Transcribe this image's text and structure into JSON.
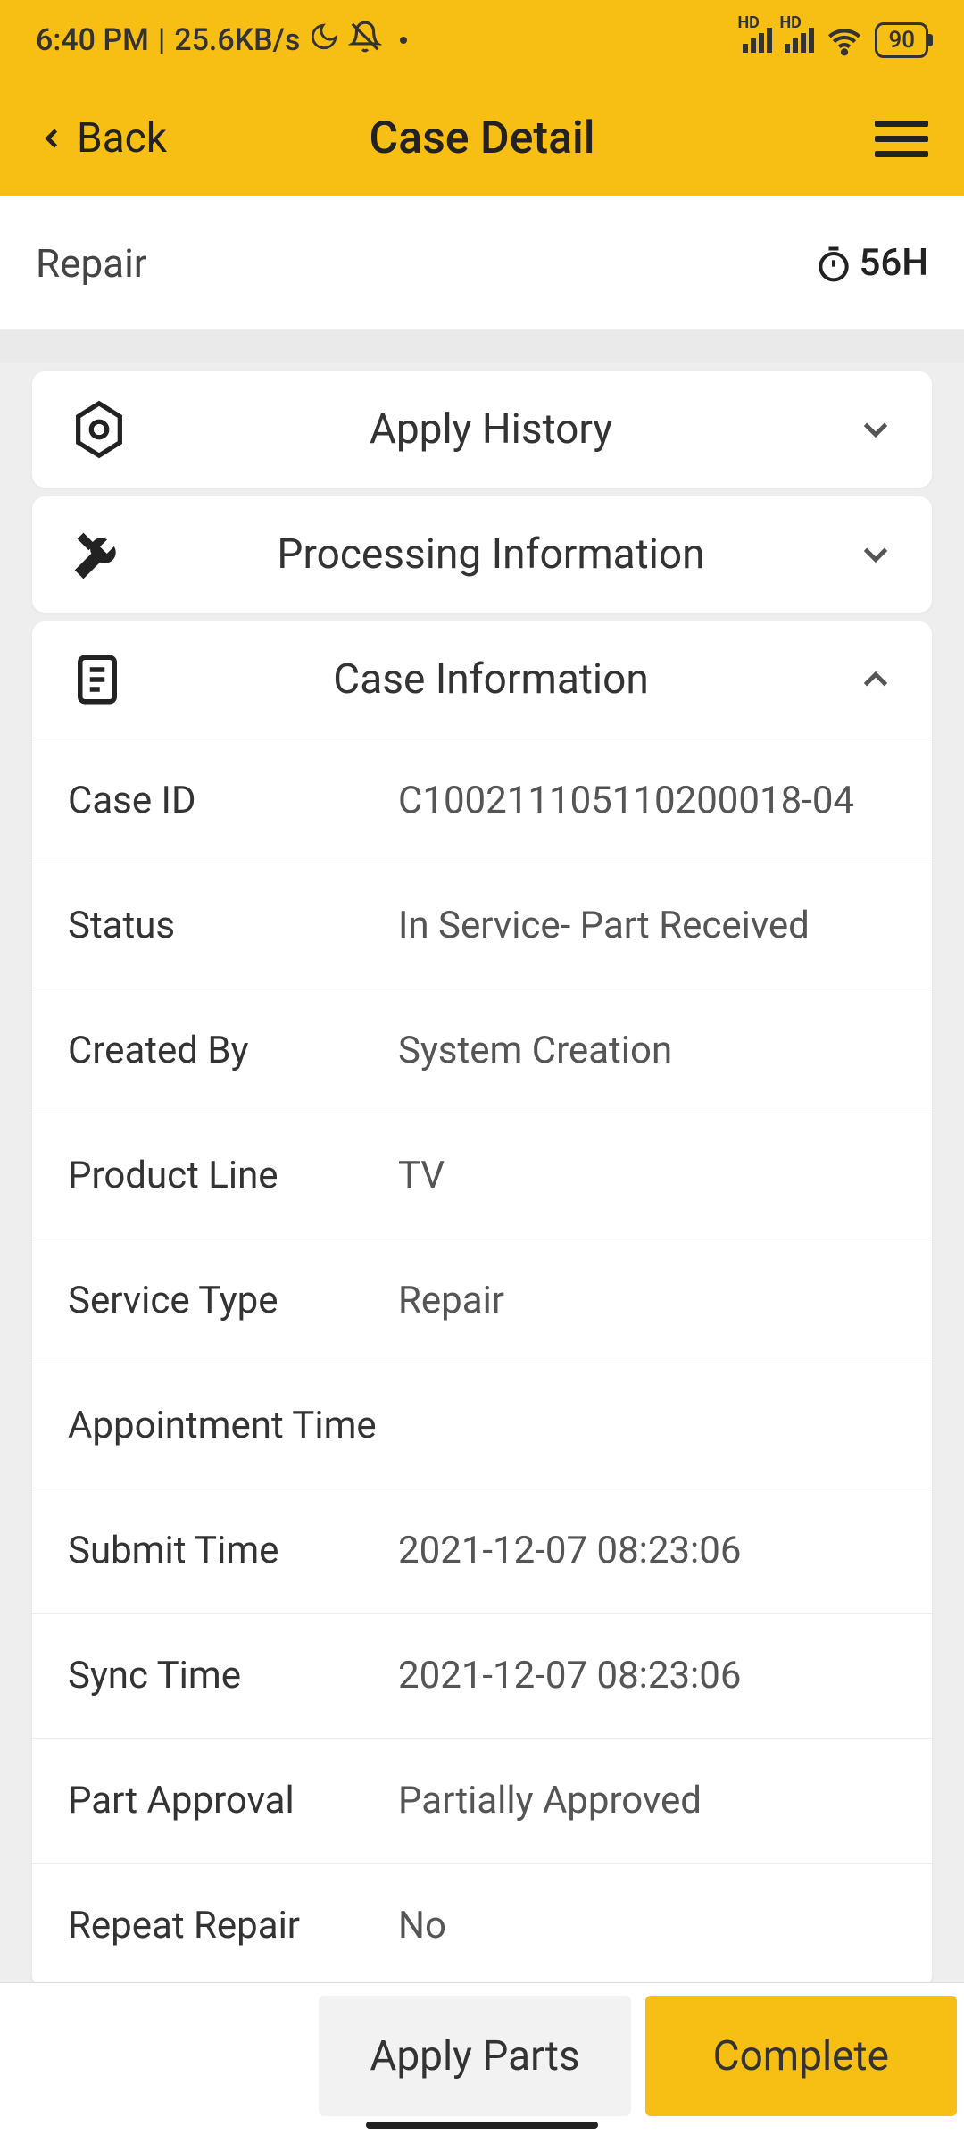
{
  "status_bar": {
    "time": "6:40 PM",
    "sep": " | ",
    "net_speed": "25.6KB/s",
    "hd1_label": "HD",
    "hd2_label": "HD",
    "battery_pct": "90"
  },
  "header": {
    "back_label": "Back",
    "title": "Case Detail"
  },
  "sub_header": {
    "category": "Repair",
    "timer_value": "56H"
  },
  "sections": {
    "apply_history": {
      "title": "Apply History",
      "expanded": false
    },
    "processing_info": {
      "title": "Processing Information",
      "expanded": false
    },
    "case_info": {
      "title": "Case Information",
      "expanded": true
    }
  },
  "case_info_rows": [
    {
      "label": "Case ID",
      "value": "C100211105110200018-04"
    },
    {
      "label": "Status",
      "value": "In Service- Part Received"
    },
    {
      "label": "Created By",
      "value": "System Creation"
    },
    {
      "label": "Product Line",
      "value": "TV"
    },
    {
      "label": "Service Type",
      "value": "Repair"
    },
    {
      "label": "Appointment Time",
      "value": ""
    },
    {
      "label": "Submit Time",
      "value": "2021-12-07 08:23:06"
    },
    {
      "label": "Sync Time",
      "value": "2021-12-07 08:23:06"
    },
    {
      "label": "Part Approval",
      "value": "Partially Approved"
    },
    {
      "label": "Repeat Repair",
      "value": "No"
    }
  ],
  "bottom_bar": {
    "apply_parts": "Apply Parts",
    "complete": "Complete"
  }
}
